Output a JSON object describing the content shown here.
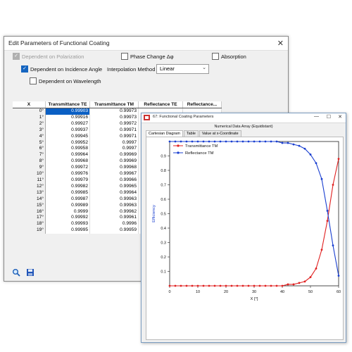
{
  "dialog": {
    "title": "Edit Parameters of Functional Coating",
    "close_glyph": "✕",
    "options": {
      "polarization_label": "Dependent on Polarization",
      "phase_label": "Phase Change Δφ",
      "absorption_label": "Absorption",
      "incidence_label": "Dependent on Incidence Angle",
      "interpolation_label": "Interpolation Method",
      "interpolation_value": "Linear",
      "wavelength_label": "Dependent on Wavelength"
    },
    "table": {
      "headers": [
        "X",
        "Transmittance TE",
        "Transmittance TM",
        "Reflectance TE",
        "Reflectance..."
      ],
      "rows": [
        [
          "0°",
          "0.99903",
          "0.99973"
        ],
        [
          "1°",
          "0.99916",
          "0.99973"
        ],
        [
          "2°",
          "0.99927",
          "0.99972"
        ],
        [
          "3°",
          "0.99937",
          "0.99971"
        ],
        [
          "4°",
          "0.99945",
          "0.99971"
        ],
        [
          "5°",
          "0.99952",
          "0.9997"
        ],
        [
          "6°",
          "0.99958",
          "0.9997"
        ],
        [
          "7°",
          "0.99964",
          "0.99969"
        ],
        [
          "8°",
          "0.99968",
          "0.99969"
        ],
        [
          "9°",
          "0.99972",
          "0.99968"
        ],
        [
          "10°",
          "0.99976",
          "0.99967"
        ],
        [
          "11°",
          "0.99979",
          "0.99966"
        ],
        [
          "12°",
          "0.99982",
          "0.99965"
        ],
        [
          "13°",
          "0.99985",
          "0.99964"
        ],
        [
          "14°",
          "0.99987",
          "0.99963"
        ],
        [
          "15°",
          "0.99989",
          "0.99963"
        ],
        [
          "16°",
          "0.9999",
          "0.99962"
        ],
        [
          "17°",
          "0.99992",
          "0.99961"
        ],
        [
          "18°",
          "0.99993",
          "0.9996"
        ],
        [
          "19°",
          "0.99995",
          "0.99959"
        ]
      ]
    },
    "toolbar": {
      "zoom_icon": "magnifier-icon",
      "save_icon": "floppy-icon"
    }
  },
  "chart_window": {
    "title": "67: Functional Coating Parameters",
    "subtitle": "Numerical Data Array (Equidistant)",
    "tabs": [
      "Cartesian Diagram",
      "Table",
      "Value at x-Coordinate"
    ],
    "active_tab": "Cartesian Diagram",
    "min_glyph": "—",
    "max_glyph": "☐",
    "close_glyph": "✕"
  },
  "chart_data": {
    "type": "line",
    "xlabel": "X [°]",
    "ylabel": "Efficiency",
    "xlim": [
      0,
      60
    ],
    "ylim": [
      0,
      1
    ],
    "xticks": [
      0,
      10,
      20,
      30,
      40,
      50,
      60
    ],
    "yticks": [
      0.1,
      0.2,
      0.3,
      0.4,
      0.5,
      0.6,
      0.7,
      0.8,
      0.9
    ],
    "x": [
      0,
      2,
      4,
      6,
      8,
      10,
      12,
      14,
      16,
      18,
      20,
      22,
      24,
      26,
      28,
      30,
      32,
      34,
      36,
      38,
      40,
      42,
      44,
      46,
      48,
      50,
      52,
      54,
      56,
      58,
      60
    ],
    "series": [
      {
        "name": "Transmittance TM",
        "color": "#e02020",
        "values": [
          0.0,
          0.0,
          0.0,
          0.0,
          0.0,
          0.0,
          0.0,
          0.0,
          0.0,
          0.0,
          0.0,
          0.0,
          0.0,
          0.0,
          0.0,
          0.0,
          0.0,
          0.0,
          0.0,
          0.0,
          0.0,
          0.01,
          0.01,
          0.02,
          0.03,
          0.06,
          0.12,
          0.25,
          0.45,
          0.7,
          0.88
        ]
      },
      {
        "name": "Reflectance TM",
        "color": "#1a3fd0",
        "values": [
          1.0,
          1.0,
          1.0,
          1.0,
          1.0,
          1.0,
          1.0,
          1.0,
          1.0,
          1.0,
          1.0,
          1.0,
          1.0,
          1.0,
          1.0,
          1.0,
          1.0,
          1.0,
          1.0,
          1.0,
          0.99,
          0.99,
          0.98,
          0.97,
          0.95,
          0.91,
          0.85,
          0.74,
          0.52,
          0.28,
          0.07
        ]
      }
    ],
    "legend_position": "top-left",
    "grid": false
  }
}
